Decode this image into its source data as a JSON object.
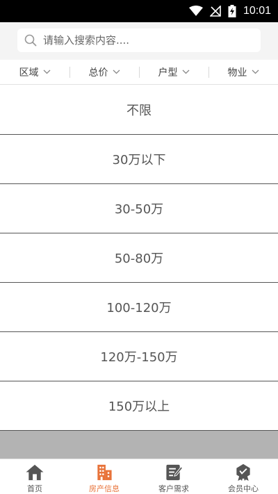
{
  "status": {
    "time": "10:01"
  },
  "search": {
    "placeholder": "请输入搜索内容...."
  },
  "filters": [
    {
      "label": "区域"
    },
    {
      "label": "总价"
    },
    {
      "label": "户型"
    },
    {
      "label": "物业"
    }
  ],
  "price_options": [
    "不限",
    "30万以下",
    "30-50万",
    "50-80万",
    "100-120万",
    "120万-150万",
    "150万以上"
  ],
  "tabs": [
    {
      "label": "首页",
      "icon": "home-icon"
    },
    {
      "label": "房产信息",
      "icon": "building-icon",
      "active": true
    },
    {
      "label": "客户需求",
      "icon": "edit-note-icon"
    },
    {
      "label": "会员中心",
      "icon": "member-badge-icon"
    }
  ],
  "colors": {
    "accent": "#e8733a",
    "icon_gray": "#555555",
    "overlay": "#b3b3b3"
  }
}
